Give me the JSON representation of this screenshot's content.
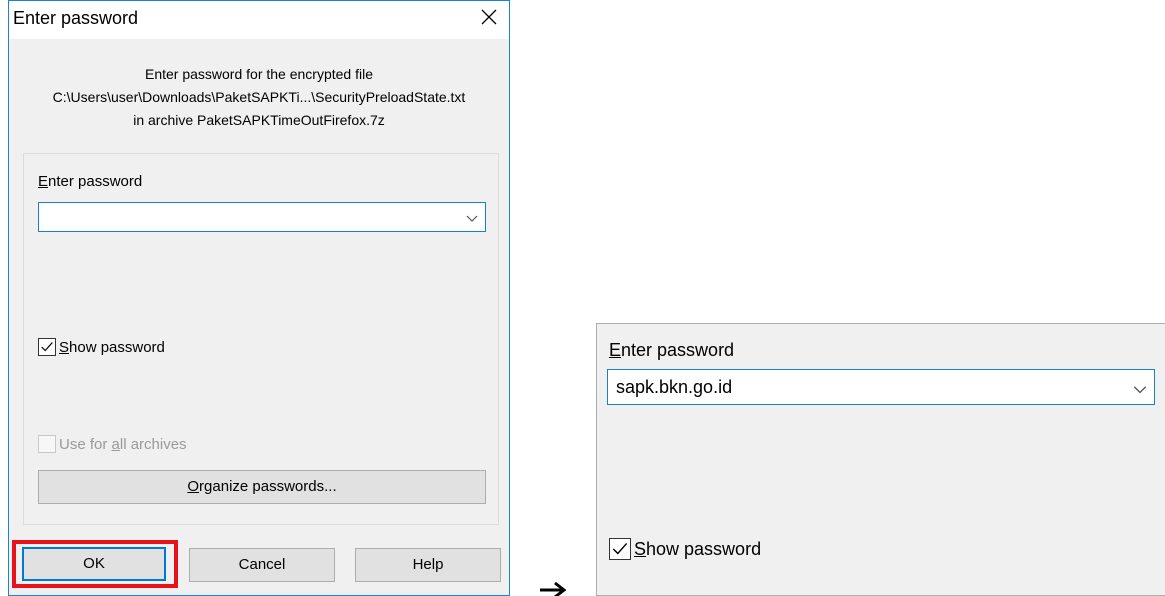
{
  "dialog": {
    "title": "Enter password",
    "message_line1": "Enter password for the encrypted file",
    "message_line2": "C:\\Users\\user\\Downloads\\PaketSAPKTi...\\SecurityPreloadState.txt",
    "message_line3": "in archive PaketSAPKTimeOutFirefox.7z",
    "password_label_accel": "E",
    "password_label_rest": "nter password",
    "password_value": "",
    "show_password_accel": "S",
    "show_password_rest": "how password",
    "show_password_checked": true,
    "use_all_pre": "Use for ",
    "use_all_accel": "a",
    "use_all_post": "ll archives",
    "use_all_checked": false,
    "organize_accel": "O",
    "organize_rest": "rganize passwords...",
    "ok_label": "OK",
    "cancel_label": "Cancel",
    "help_label": "Help"
  },
  "zoom": {
    "password_label_accel": "E",
    "password_label_rest": "nter password",
    "password_value": "sapk.bkn.go.id",
    "show_password_accel": "S",
    "show_password_rest": "how password",
    "show_password_checked": true
  },
  "colors": {
    "highlight": "#e8121b",
    "focus_border": "#0078d7"
  },
  "icons": [
    "close-icon",
    "chevron-down-icon",
    "checkmark-icon",
    "arrow-right-icon"
  ]
}
